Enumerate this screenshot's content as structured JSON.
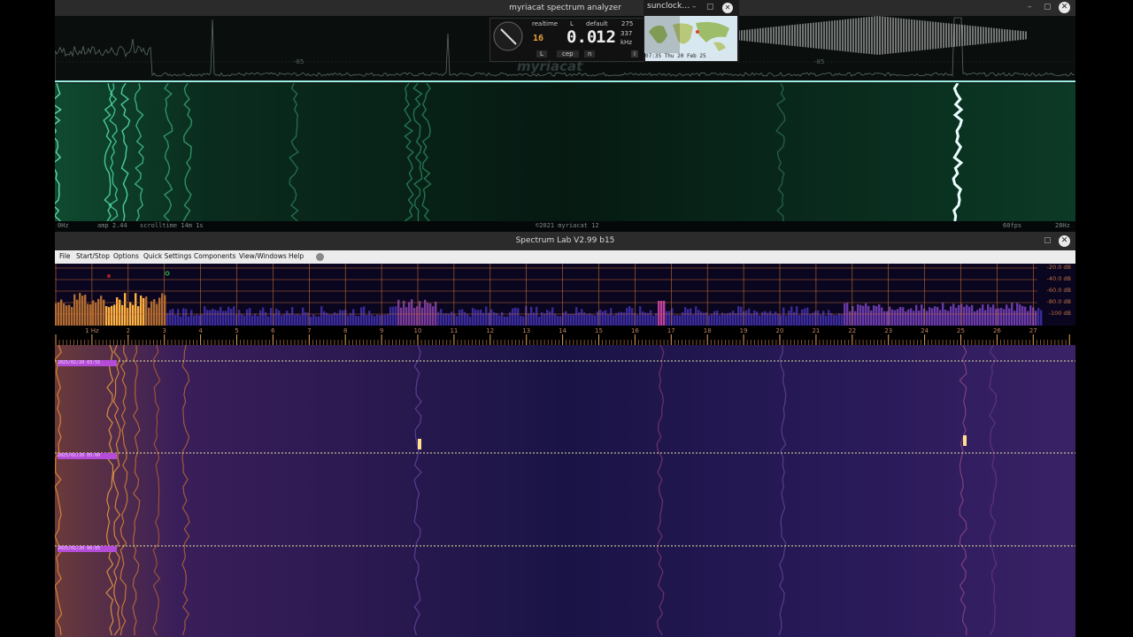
{
  "myriacat": {
    "title": "myriacat spectrum analyzer",
    "min_button": "–",
    "max_button": "▢",
    "close_button": "✕",
    "db_marker_left": "-85",
    "db_marker_right": "-85",
    "status": {
      "freq_low": "0Hz",
      "amp": "amp 2.44",
      "scrolltime": "scrolltime 14m 1s",
      "copyright": "©2021 myriacat 12",
      "fps": "60fps",
      "freq_high": "28Hz"
    },
    "widget": {
      "mode": "realtime",
      "channel": "L",
      "preset": "default",
      "num1": "275",
      "num2": "337",
      "unit": "kHz",
      "small_digits": "16",
      "big_readout": "0.0",
      "big_readout2": "12",
      "btn_l": "L",
      "btn_cep": "cep",
      "btn_n": "n",
      "info": "i",
      "watermark": "myriacat"
    }
  },
  "sunclock": {
    "title": "sunclock…",
    "min_button": "–",
    "max_button": "▢",
    "close_button": "✕",
    "time": "07:35 Thu 20 Feb 25"
  },
  "spectrumlab": {
    "title": "Spectrum Lab V2.99 b15",
    "max_button": "▢",
    "close_button": "✕",
    "menu": [
      "File",
      "Start/Stop",
      "Options",
      "Quick Settings",
      "Components",
      "View/Windows",
      "Help"
    ],
    "db_labels": [
      "-20.0 dB",
      "-40.0 dB",
      "-60.0 dB",
      "-80.0 dB",
      "-100 dB"
    ],
    "freq_labels": [
      "1 Hz",
      "2",
      "3",
      "4",
      "5",
      "6",
      "7",
      "8",
      "9",
      "10",
      "11",
      "12",
      "13",
      "14",
      "15",
      "16",
      "17",
      "18",
      "19",
      "20",
      "21",
      "22",
      "23",
      "24",
      "25",
      "26",
      "27"
    ],
    "timestamps": [
      "2025/02/20 03:55",
      "2025/02/20 05:00",
      "2025/02/20 06:05"
    ]
  },
  "colors": {
    "myriacat_trace": "#9bf0e4",
    "myriacat_waterfall": "#1c8a5c",
    "spectrumlab_grid": "#c06a30",
    "spectrumlab_hot": "#ffb040",
    "spectrumlab_bg": "#14124a",
    "timestamp_bg": "#b44cd8"
  }
}
